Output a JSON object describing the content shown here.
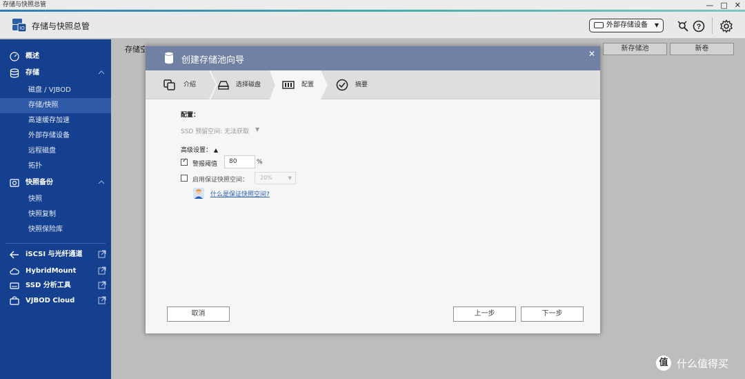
{
  "window": {
    "title": "存储与快照总管",
    "controls": [
      "minimize",
      "maximize",
      "close"
    ]
  },
  "header": {
    "app_title": "存储与快照总管",
    "external_device_label": "外部存储设备",
    "icons": [
      "debug-icon",
      "help-icon",
      "settings-icon"
    ]
  },
  "sidebar": {
    "sections": [
      {
        "label": "概述",
        "icon": "dashboard-icon"
      },
      {
        "label": "存储",
        "icon": "storage-icon",
        "expanded": true,
        "items": [
          "磁盘 / VJBOD",
          "存储/快照",
          "高速缓存加速",
          "外部存储设备",
          "远程磁盘",
          "拓扑"
        ]
      },
      {
        "label": "快照备份",
        "icon": "snapshot-icon",
        "expanded": true,
        "items": [
          "快照",
          "快照复制",
          "快照保险库"
        ]
      },
      {
        "label": "iSCSI 与光纤通道",
        "icon": "iscsi-icon"
      },
      {
        "label": "HybridMount",
        "icon": "cloud-icon"
      },
      {
        "label": "SSD 分析工具",
        "icon": "ssd-icon"
      },
      {
        "label": "VJBOD Cloud",
        "icon": "vjbod-cloud-icon"
      }
    ],
    "active_item": "存储/快照"
  },
  "main": {
    "label": "存储空",
    "new_pool_button": "新存储池",
    "new_volume_button": "新卷"
  },
  "dialog": {
    "title": "创建存储池向导",
    "steps": [
      {
        "label": "介绍",
        "icon": "intro-icon"
      },
      {
        "label": "选择磁盘",
        "icon": "disk-icon"
      },
      {
        "label": "配置",
        "icon": "config-icon",
        "active": true
      },
      {
        "label": "摘要",
        "icon": "summary-check-icon"
      }
    ],
    "config_heading": "配置：",
    "ssd_reserve_label": "SSD 预留空间:",
    "ssd_reserve_value": "无法获取",
    "advanced_label": "高级设置：",
    "alert_threshold": {
      "label": "警报阈值",
      "checked": true,
      "value": "80",
      "unit": "%"
    },
    "guaranteed_snapshot": {
      "label": "启用保证快照空间：",
      "checked": false,
      "value": "20%"
    },
    "help_link": "什么是保证快照空间?",
    "buttons": {
      "cancel": "取消",
      "back": "上一步",
      "next": "下一步"
    }
  },
  "watermark": {
    "badge": "值",
    "text": "什么值得买"
  }
}
